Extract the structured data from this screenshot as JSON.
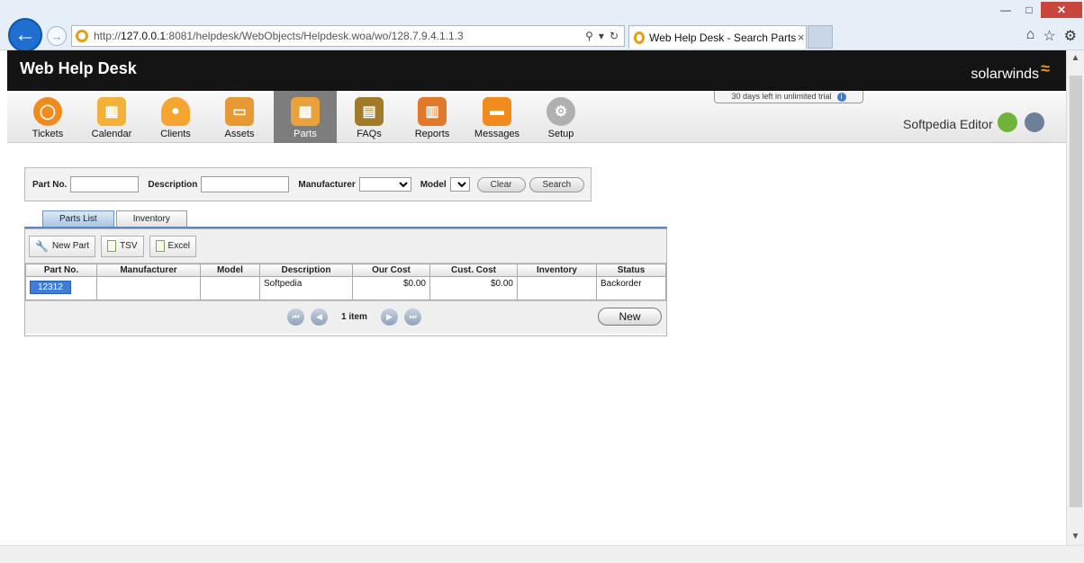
{
  "browser": {
    "url_prefix": "http://",
    "url_host": "127.0.0.1",
    "url_rest": ":8081/helpdesk/WebObjects/Helpdesk.woa/wo/128.7.9.4.1.1.3",
    "tab_title": "Web Help Desk - Search Parts",
    "tab_close": "×"
  },
  "app": {
    "title": "Web Help Desk",
    "brand": "solarwinds",
    "trial_text": "30 days left in unlimited trial",
    "user_name": "Softpedia Editor"
  },
  "nav": [
    {
      "label": "Tickets",
      "color": "#f28b1e",
      "icon": "lifebuoy-icon"
    },
    {
      "label": "Calendar",
      "color": "#f3b13a",
      "icon": "calendar-icon"
    },
    {
      "label": "Clients",
      "color": "#f6a531",
      "icon": "person-icon"
    },
    {
      "label": "Assets",
      "color": "#e79a34",
      "icon": "monitor-icon"
    },
    {
      "label": "Parts",
      "color": "#e9a23b",
      "icon": "parts-icon"
    },
    {
      "label": "FAQs",
      "color": "#a17a2a",
      "icon": "book-icon"
    },
    {
      "label": "Reports",
      "color": "#e2782a",
      "icon": "chart-icon"
    },
    {
      "label": "Messages",
      "color": "#f28b1e",
      "icon": "messages-icon"
    },
    {
      "label": "Setup",
      "color": "#9a9a9a",
      "icon": "gear-icon"
    }
  ],
  "search": {
    "part_no_label": "Part No.",
    "part_no_value": "",
    "description_label": "Description",
    "description_value": "",
    "manufacturer_label": "Manufacturer",
    "manufacturer_value": "",
    "model_label": "Model",
    "model_value": "",
    "clear_label": "Clear",
    "search_label": "Search"
  },
  "tabs": {
    "parts_list": "Parts List",
    "inventory": "Inventory"
  },
  "toolbar": {
    "new_part": "New Part",
    "tsv": "TSV",
    "excel": "Excel"
  },
  "table": {
    "headers": [
      "Part No.",
      "Manufacturer",
      "Model",
      "Description",
      "Our Cost",
      "Cust. Cost",
      "Inventory",
      "Status"
    ],
    "rows": [
      {
        "part_no": "12312",
        "manufacturer": "",
        "model": "",
        "description": "Softpedia",
        "our_cost": "$0.00",
        "cust_cost": "$0.00",
        "inventory": "",
        "status": "Backorder"
      }
    ]
  },
  "pager": {
    "item_count": "1 item",
    "new_label": "New"
  }
}
